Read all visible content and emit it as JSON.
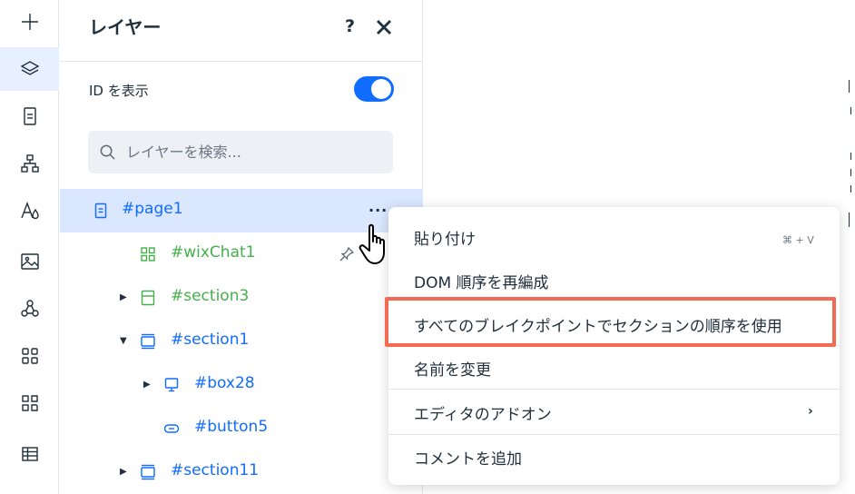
{
  "rail": {
    "items": [
      {
        "name": "add-icon"
      },
      {
        "name": "layers-icon",
        "active": true
      },
      {
        "name": "pages-icon"
      },
      {
        "name": "sitemap-icon"
      },
      {
        "name": "design-icon"
      },
      {
        "name": "media-icon"
      },
      {
        "name": "cms-icon"
      },
      {
        "name": "apps-icon"
      },
      {
        "name": "addons-icon"
      },
      {
        "name": "table-icon"
      }
    ]
  },
  "panel": {
    "title": "レイヤー",
    "help_label": "?",
    "show_id_label": "ID を表示",
    "show_id_enabled": true,
    "search_placeholder": "レイヤーを検索..."
  },
  "layers": [
    {
      "name": "#page1",
      "color": "#116dff",
      "icon": "page-icon",
      "selected": true,
      "arrow": ""
    },
    {
      "name": "#wixChat1",
      "color": "#43b14b",
      "icon": "widget-icon",
      "arrow": "",
      "pinned": true
    },
    {
      "name": "#section3",
      "color": "#43b14b",
      "icon": "section-icon",
      "arrow": "▶"
    },
    {
      "name": "#section1",
      "color": "#116dff",
      "icon": "section-icon",
      "arrow": "▼"
    },
    {
      "name": "#box28",
      "color": "#116dff",
      "icon": "box-icon",
      "arrow": "▶"
    },
    {
      "name": "#button5",
      "color": "#116dff",
      "icon": "button-icon",
      "arrow": ""
    },
    {
      "name": "#section11",
      "color": "#116dff",
      "icon": "section-icon",
      "arrow": "▶"
    }
  ],
  "context_menu": {
    "items": [
      {
        "label": "貼り付け",
        "shortcut": "⌘ + V"
      },
      {
        "label": "DOM 順序を再編成"
      },
      {
        "label": "すべてのブレイクポイントでセクションの順序を使用",
        "highlighted": true
      },
      {
        "label": "名前を変更"
      },
      {
        "label": "エディタのアドオン",
        "submenu": "›"
      },
      {
        "label": "コメントを追加"
      }
    ]
  },
  "colors": {
    "accent": "#116dff",
    "green": "#43b14b",
    "highlight_border": "#f26b52",
    "selected_row": "#dbe7ff"
  }
}
